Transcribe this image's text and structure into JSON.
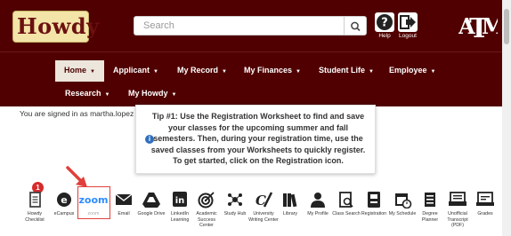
{
  "header": {
    "logo_text": "Howdy",
    "search_placeholder": "Search",
    "help_label": "Help",
    "logout_label": "Logout",
    "university_mark": "ATM"
  },
  "nav": {
    "items": [
      {
        "label": "Home"
      },
      {
        "label": "Applicant"
      },
      {
        "label": "My Record"
      },
      {
        "label": "My Finances"
      },
      {
        "label": "Student Life"
      },
      {
        "label": "Employee"
      },
      {
        "label": "Research"
      },
      {
        "label": "My Howdy"
      }
    ]
  },
  "signed_in_text": "You are signed in as martha.lopez",
  "tip": {
    "text": "Tip #1: Use the Registration Worksheet to find and save your classes for the upcoming summer and fall semesters. Then, during your registration time, use the saved classes from your Worksheets to quickly register. To get started, click on the Registration icon."
  },
  "badge_count": "1",
  "apps": [
    {
      "label": "Howdy Checklist",
      "icon": "checklist-icon"
    },
    {
      "label": "eCampus",
      "icon": "ecampus-icon"
    },
    {
      "label": "zoom",
      "icon": "zoom-icon"
    },
    {
      "label": "Email",
      "icon": "email-icon"
    },
    {
      "label": "Google Drive",
      "icon": "google-drive-icon"
    },
    {
      "label": "LinkedIn Learning",
      "icon": "linkedin-icon"
    },
    {
      "label": "Academic Success Center",
      "icon": "target-icon"
    },
    {
      "label": "Study Hub",
      "icon": "study-hub-icon"
    },
    {
      "label": "University Writing Center",
      "icon": "writing-icon"
    },
    {
      "label": "Library",
      "icon": "library-icon"
    },
    {
      "label": "My Profile",
      "icon": "profile-icon"
    },
    {
      "label": "Class Search",
      "icon": "class-search-icon"
    },
    {
      "label": "Registration",
      "icon": "registration-icon"
    },
    {
      "label": "My Schedule",
      "icon": "calendar-icon"
    },
    {
      "label": "Degree Planner",
      "icon": "degree-planner-icon"
    },
    {
      "label": "Unofficial Transcript (PDF)",
      "icon": "transcript-icon"
    },
    {
      "label": "Grades",
      "icon": "grades-icon"
    }
  ],
  "colors": {
    "maroon": "#500000",
    "nav_active_bg": "#ece6dc",
    "badge_red": "#d62b2b",
    "highlight_red": "#e0403b",
    "info_blue": "#2f6fbe",
    "zoom_blue": "#2d8cff"
  }
}
